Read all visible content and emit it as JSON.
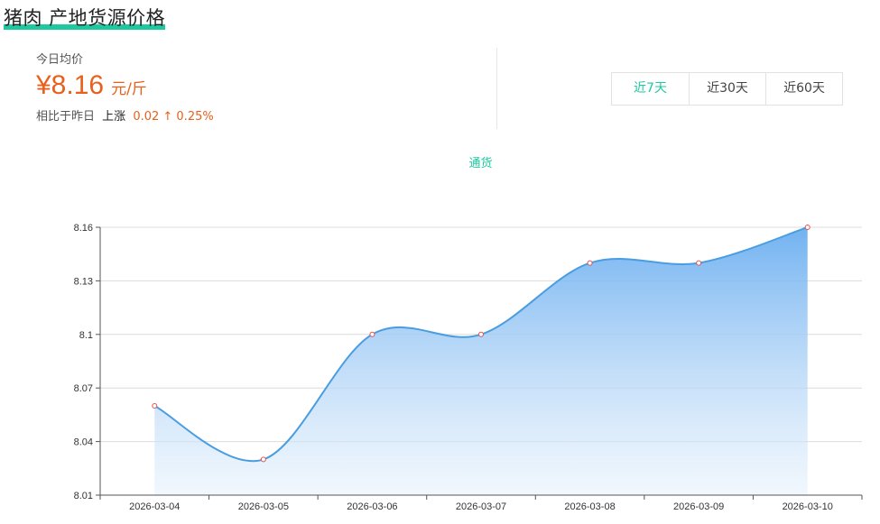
{
  "page": {
    "title": "猪肉 产地货源价格"
  },
  "summary": {
    "label": "今日均价",
    "price": "¥8.16",
    "unit": "元/斤",
    "compare_label": "相比于昨日",
    "direction": "上涨",
    "change": "0.02 ↑ 0.25%"
  },
  "range_tabs": [
    {
      "label": "近7天",
      "active": true
    },
    {
      "label": "近30天",
      "active": false
    },
    {
      "label": "近60天",
      "active": false
    }
  ],
  "colors": {
    "accent": "#1ec9a0",
    "price": "#e8601c",
    "line": "#4a9de0",
    "point_stroke": "#e05050"
  },
  "chart_data": {
    "type": "area",
    "legend": [
      "通货"
    ],
    "x": [
      "2026-03-04",
      "2026-03-05",
      "2026-03-06",
      "2026-03-07",
      "2026-03-08",
      "2026-03-09",
      "2026-03-10"
    ],
    "series": [
      {
        "name": "通货",
        "values": [
          8.06,
          8.03,
          8.1,
          8.1,
          8.14,
          8.14,
          8.16
        ]
      }
    ],
    "y_ticks": [
      "8.01",
      "8.04",
      "8.07",
      "8.1",
      "8.13",
      "8.16"
    ],
    "ylim": [
      8.01,
      8.16
    ],
    "smooth": true,
    "grid": true
  }
}
